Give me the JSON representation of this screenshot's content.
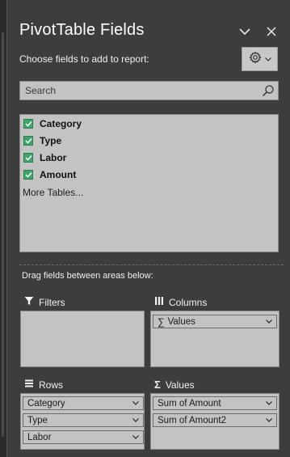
{
  "pane": {
    "title": "PivotTable Fields",
    "choose_label": "Choose fields to add to report:",
    "search": {
      "placeholder": "Search"
    },
    "fields": [
      {
        "label": "Category",
        "checked": true
      },
      {
        "label": "Type",
        "checked": true
      },
      {
        "label": "Labor",
        "checked": true
      },
      {
        "label": "Amount",
        "checked": true
      }
    ],
    "more_tables": "More Tables...",
    "drag_label": "Drag fields between areas below:"
  },
  "areas": {
    "filters": {
      "label": "Filters",
      "items": []
    },
    "columns": {
      "label": "Columns",
      "items": [
        "Values"
      ]
    },
    "rows": {
      "label": "Rows",
      "items": [
        "Category",
        "Type",
        "Labor"
      ]
    },
    "values": {
      "label": "Values",
      "items": [
        "Sum of Amount",
        "Sum of Amount2"
      ]
    }
  },
  "icons": {
    "header": [
      "chevron-down-icon",
      "close-icon"
    ],
    "gear": "gear-icon",
    "search": "search-icon",
    "filters": "filter-icon",
    "columns": "columns-icon",
    "rows": "rows-icon",
    "values": "sigma-icon"
  },
  "colors": {
    "pane_bg": "#3d3d3d",
    "box_bg": "#c3c3c3",
    "checkbox": "#3fa56a"
  }
}
